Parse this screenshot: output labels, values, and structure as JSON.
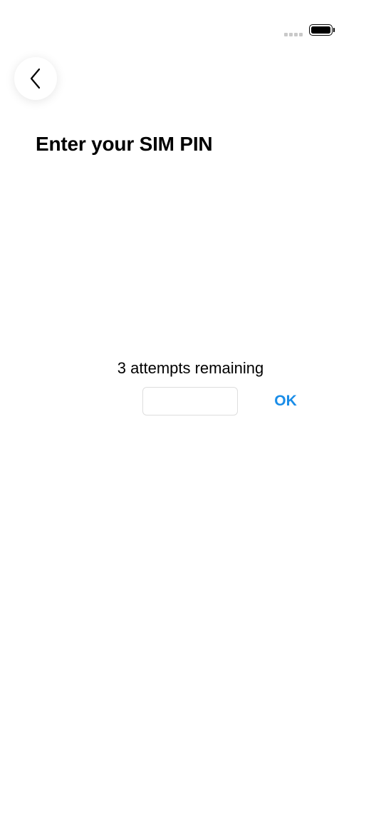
{
  "status_bar": {
    "signal_icon": "signal-dots-icon",
    "battery_icon": "battery-full-icon",
    "battery_level": 1.0
  },
  "header": {
    "back_icon": "chevron-left-icon",
    "title": "Enter your SIM PIN"
  },
  "pin_entry": {
    "attempts_text": "3 attempts remaining",
    "input_value": "",
    "ok_label": "OK"
  },
  "colors": {
    "accent": "#1a8de8",
    "background": "#ffffff",
    "text": "#000000"
  }
}
